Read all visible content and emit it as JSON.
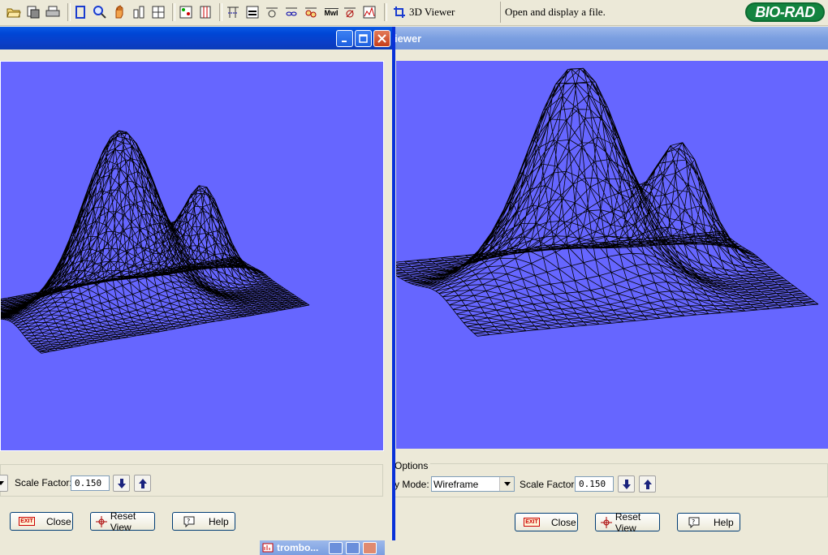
{
  "toolbar": {
    "icons": [
      "open-folder-icon",
      "print-setup-icon",
      "print-icon",
      "crop-icon",
      "zoom-icon",
      "pan-hand-icon",
      "tool-icon",
      "grid-icon",
      "analyze-icon",
      "columns-icon",
      "lane-icon",
      "band-icon",
      "band-attributes-icon",
      "match-icon",
      "overlay-icon",
      "mw-icon",
      "quantity-icon",
      "trace-icon"
    ],
    "mwi_label": "MwI",
    "viewer_label": "3D Viewer",
    "status": "Open and display a file.",
    "logo": "BIO-RAD"
  },
  "back_window": {
    "title": "iewer",
    "group_label": "Options",
    "mode_label": "y Mode:",
    "mode_value": "Wireframe",
    "scale_label": "Scale Factor:",
    "scale_value": "0.150",
    "close_label": "Close",
    "reset_label": "Reset View",
    "help_label": "Help"
  },
  "front_window": {
    "scale_label": "Scale Factor:",
    "scale_value": "0.150",
    "close_label": "Close",
    "reset_label": "Reset View",
    "help_label": "Help"
  },
  "taskbar": {
    "item_label": "trombo..."
  },
  "colors": {
    "viewport": "#6666ff",
    "mesh": "#000000",
    "titlebar_active": "#0046d5"
  }
}
